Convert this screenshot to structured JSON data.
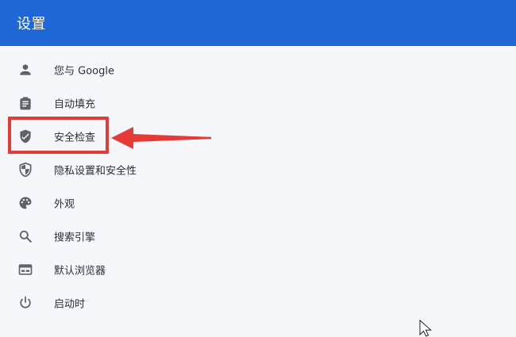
{
  "app": {
    "title": "设置"
  },
  "sidebar": {
    "items": [
      {
        "label": "您与 Google",
        "icon": "person-icon"
      },
      {
        "label": "自动填充",
        "icon": "clipboard-icon"
      },
      {
        "label": "安全检查",
        "icon": "shield-check-icon",
        "highlighted": true
      },
      {
        "label": "隐私设置和安全性",
        "icon": "shield-half-icon"
      },
      {
        "label": "外观",
        "icon": "palette-icon"
      },
      {
        "label": "搜索引擎",
        "icon": "search-icon"
      },
      {
        "label": "默认浏览器",
        "icon": "browser-window-icon"
      },
      {
        "label": "启动时",
        "icon": "power-icon"
      }
    ]
  },
  "annotation": {
    "highlight_color": "#e53b36",
    "arrow_color": "#e53b36"
  },
  "colors": {
    "header": "#1f66d6",
    "background": "#f5f7fb",
    "icon": "#5f6368",
    "text": "#2b2f36"
  }
}
